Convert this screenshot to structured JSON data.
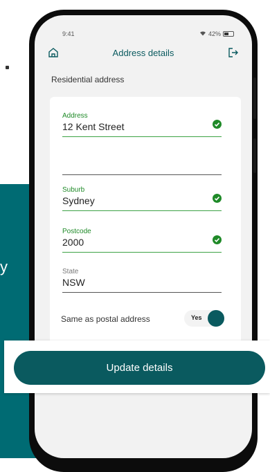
{
  "status_bar": {
    "time": "9:41",
    "battery": "42%"
  },
  "header": {
    "title": "Address details",
    "home_icon": "home-icon",
    "logout_icon": "logout-icon"
  },
  "section": {
    "title": "Residential address"
  },
  "form": {
    "address": {
      "label": "Address",
      "value": "12 Kent Street"
    },
    "address_line2": {
      "value": ""
    },
    "suburb": {
      "label": "Suburb",
      "value": "Sydney"
    },
    "postcode": {
      "label": "Postcode",
      "value": "2000"
    },
    "state": {
      "label": "State",
      "value": "NSW"
    }
  },
  "toggle": {
    "label": "Same as postal address",
    "value": "Yes"
  },
  "actions": {
    "update_label": "Update details"
  },
  "background": {
    "letter": "y"
  },
  "colors": {
    "brand": "#0a5a5f",
    "valid": "#1f8a28",
    "teal_panel": "#006b73"
  }
}
